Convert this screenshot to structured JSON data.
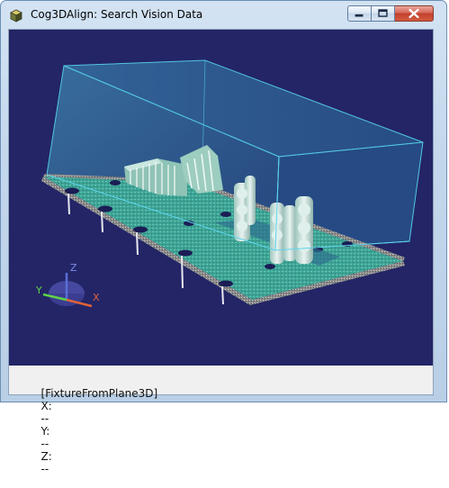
{
  "window": {
    "title": "Cog3DAlign: Search Vision Data"
  },
  "viewport": {
    "background": "#232566",
    "axes": {
      "x_label": "X",
      "y_label": "Y",
      "z_label": "Z",
      "x_color": "#e0623a",
      "y_color": "#5fd24a",
      "z_color": "#5a6fd8"
    }
  },
  "status": {
    "fixture": "[FixtureFromPlane3D]",
    "x_label": "X:",
    "x_value": "--",
    "y_label": "Y:",
    "y_value": "--",
    "z_label": "Z:",
    "z_value": "--"
  }
}
